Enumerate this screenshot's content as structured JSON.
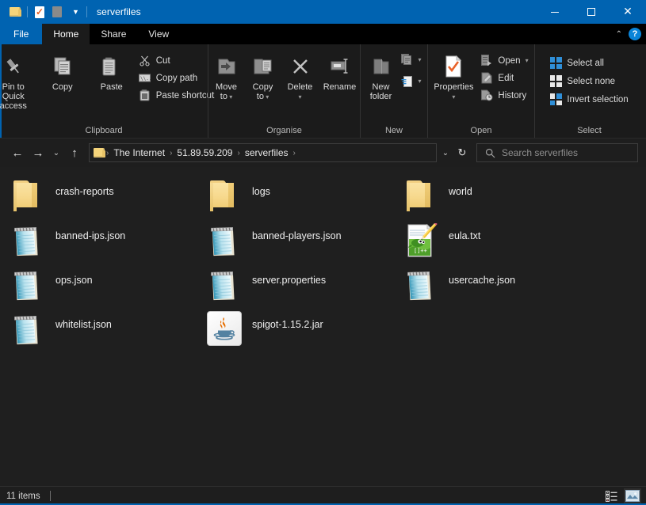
{
  "window": {
    "title": "serverfiles",
    "quick_access": [
      {
        "name": "folder-icon",
        "label": "Explorer"
      },
      {
        "name": "properties-icon",
        "label": "Properties"
      },
      {
        "name": "grey-item-icon",
        "label": "New folder"
      }
    ],
    "controls": {
      "minimize": "—",
      "maximize": "□",
      "close": "✕"
    }
  },
  "tabs": [
    {
      "id": "file",
      "label": "File"
    },
    {
      "id": "home",
      "label": "Home"
    },
    {
      "id": "share",
      "label": "Share"
    },
    {
      "id": "view",
      "label": "View"
    }
  ],
  "tab_right": {
    "collapse": "⌃",
    "help": "?"
  },
  "ribbon": {
    "groups": [
      {
        "label": "Clipboard",
        "big": [
          {
            "name": "pin-to-quick-access-button",
            "label": "Pin to Quick\naccess",
            "line1": "Pin to Quick",
            "line2": "access"
          },
          {
            "name": "copy-button",
            "label": "Copy",
            "line1": "Copy",
            "line2": ""
          },
          {
            "name": "paste-button",
            "label": "Paste",
            "line1": "Paste",
            "line2": ""
          }
        ],
        "small": [
          {
            "name": "cut-button",
            "label": "Cut"
          },
          {
            "name": "copy-path-button",
            "label": "Copy path"
          },
          {
            "name": "paste-shortcut-button",
            "label": "Paste shortcut"
          }
        ]
      },
      {
        "label": "Organise",
        "big": [
          {
            "name": "move-to-button",
            "line1": "Move",
            "line2": "to"
          },
          {
            "name": "copy-to-button",
            "line1": "Copy",
            "line2": "to"
          },
          {
            "name": "delete-button",
            "line1": "Delete",
            "line2": ""
          },
          {
            "name": "rename-button",
            "line1": "Rename",
            "line2": ""
          }
        ],
        "small": []
      },
      {
        "label": "New",
        "big": [
          {
            "name": "new-folder-button",
            "line1": "New",
            "line2": "folder"
          }
        ],
        "small": [
          {
            "name": "new-item-button",
            "label": ""
          },
          {
            "name": "easy-access-button",
            "label": ""
          }
        ]
      },
      {
        "label": "Open",
        "big": [
          {
            "name": "properties-button",
            "line1": "Properties",
            "line2": ""
          }
        ],
        "small": [
          {
            "name": "open-button",
            "label": "Open"
          },
          {
            "name": "edit-button",
            "label": "Edit"
          },
          {
            "name": "history-button",
            "label": "History"
          }
        ]
      },
      {
        "label": "Select",
        "big": [],
        "small": [
          {
            "name": "select-all-button",
            "label": "Select all"
          },
          {
            "name": "select-none-button",
            "label": "Select none"
          },
          {
            "name": "invert-selection-button",
            "label": "Invert selection"
          }
        ]
      }
    ]
  },
  "address": {
    "back": "←",
    "forward": "→",
    "recent": "⌄",
    "up": "↑",
    "breadcrumbs": [
      "The Internet",
      "51.89.59.209",
      "serverfiles"
    ],
    "separator": "›",
    "dropdown": "⌄",
    "refresh": "↻",
    "search_placeholder": "Search serverfiles",
    "search_value": ""
  },
  "files": [
    {
      "name": "crash-reports",
      "type": "folder"
    },
    {
      "name": "logs",
      "type": "folder"
    },
    {
      "name": "world",
      "type": "folder"
    },
    {
      "name": "banned-ips.json",
      "type": "notepad"
    },
    {
      "name": "banned-players.json",
      "type": "notepad"
    },
    {
      "name": "eula.txt",
      "type": "notepadpp"
    },
    {
      "name": "ops.json",
      "type": "notepad"
    },
    {
      "name": "server.properties",
      "type": "notepad"
    },
    {
      "name": "usercache.json",
      "type": "notepad"
    },
    {
      "name": "whitelist.json",
      "type": "notepad"
    },
    {
      "name": "spigot-1.15.2.jar",
      "type": "jar"
    }
  ],
  "status": {
    "item_count": "11 items",
    "views": [
      {
        "name": "details-view-button",
        "active": false
      },
      {
        "name": "large-icons-view-button",
        "active": true
      }
    ]
  },
  "colors": {
    "accent": "#0063B1",
    "window_bg": "#1f1f1f",
    "ribbon_bg": "#1b1b1b",
    "text": "#efefef",
    "folder_yellow": "#f7d98e",
    "java_orange": "#e76f00",
    "npp_green": "#7bc043"
  }
}
